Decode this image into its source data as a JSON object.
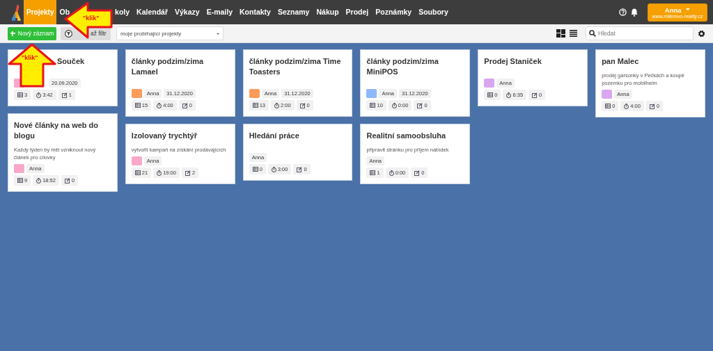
{
  "nav": {
    "items": [
      {
        "label": "Projekty",
        "selected": true
      },
      {
        "label": "Ob",
        "selected": false
      },
      {
        "label": "koly",
        "selected": false
      },
      {
        "label": "Kalendář",
        "selected": false
      },
      {
        "label": "Výkazy",
        "selected": false
      },
      {
        "label": "E-maily",
        "selected": false
      },
      {
        "label": "Kontakty",
        "selected": false
      },
      {
        "label": "Seznamy",
        "selected": false
      },
      {
        "label": "Nákup",
        "selected": false
      },
      {
        "label": "Prodej",
        "selected": false
      },
      {
        "label": "Poznámky",
        "selected": false
      },
      {
        "label": "Soubory",
        "selected": false
      }
    ],
    "user": {
      "name": "Anna",
      "site": "www.rolierovo-reality.cz"
    }
  },
  "toolbar": {
    "new_button": "Nový záznam",
    "filter_button": "až filtr",
    "filter_select": "moje probíhající projekty",
    "search": {
      "placeholder": "Hledat"
    }
  },
  "columns": [
    {
      "cards": [
        {
          "title": "Souček",
          "color": "#f9a8c9",
          "date": "20.09.2020",
          "stats": [
            "3",
            "3:42",
            "1"
          ]
        },
        {
          "title": "Nové články na web do blogu",
          "description": "Každý týden by měl vzniknout nový článek pro cílovky",
          "color": "#f9a8c9",
          "user": "Anna",
          "stats": [
            "9",
            "18:52",
            "0"
          ]
        }
      ]
    },
    {
      "cards": [
        {
          "title": "články podzim/zima Lamael",
          "color": "#fd9b5a",
          "user": "Anna",
          "date": "31.12.2020",
          "stats": [
            "15",
            "4:00",
            "0"
          ]
        },
        {
          "title": "Izolovaný trychtýř",
          "description": "vytvořit kampaň na získání prodávajících",
          "color": "#f9a8c9",
          "user": "Anna",
          "stats": [
            "21",
            "19:00",
            "2"
          ]
        }
      ]
    },
    {
      "cards": [
        {
          "title": "články podzim/zima Time Toasters",
          "color": "#fd9b5a",
          "user": "Anna",
          "date": "31.12.2020",
          "stats": [
            "13",
            "2:00",
            "0"
          ]
        },
        {
          "title": "Hledání práce",
          "user": "Anna",
          "stats": [
            "0",
            "3:00",
            "0"
          ]
        }
      ]
    },
    {
      "cards": [
        {
          "title": "články podzim/zima MiniPOS",
          "color": "#8db8fb",
          "user": "Anna",
          "date": "31.12.2020",
          "stats": [
            "10",
            "0:00",
            "0"
          ]
        },
        {
          "title": "Realitní samoobsluha",
          "description": "připravit stránku pro příjem nabídek",
          "user": "Anna",
          "stats": [
            "1",
            "0:00",
            "0"
          ]
        }
      ]
    },
    {
      "cards": [
        {
          "title": "Prodej Staniček",
          "color": "#d9a6f0",
          "user": "Anna",
          "stats": [
            "0",
            "6:35",
            "0"
          ]
        }
      ]
    },
    {
      "cards": [
        {
          "title": "pan Malec",
          "description": "prodej garsonky v Pečkách a koupě pozemku pro mobilheim",
          "color": "#d9a6f0",
          "user": "Anna",
          "stats": [
            "0",
            "4:00",
            "0"
          ]
        }
      ]
    }
  ],
  "annotations": [
    {
      "kind": "left",
      "label": "\"klik\""
    },
    {
      "kind": "up",
      "label": "\"klik\""
    }
  ]
}
